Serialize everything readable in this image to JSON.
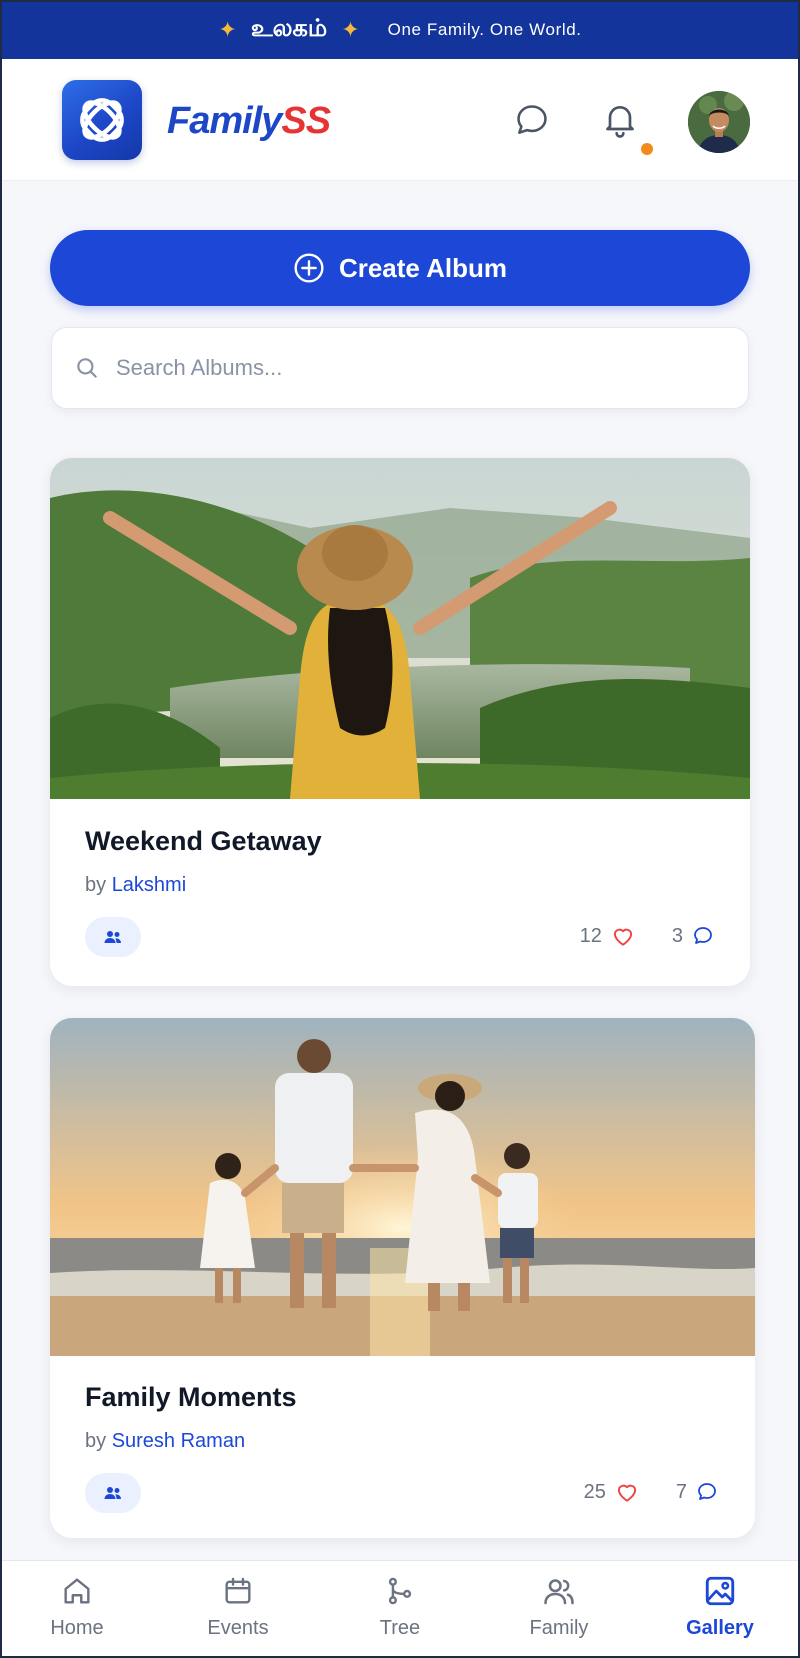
{
  "banner": {
    "title_tamil": "உலகம்",
    "tagline": "One Family. One World.",
    "star_color": "#f5b83d",
    "background_color": "#13349a"
  },
  "header": {
    "brand_part1": "Family",
    "brand_part2": "SS",
    "brand_colors": [
      "#1d47c7",
      "#e63434"
    ],
    "icons": [
      "chat-icon",
      "bell-icon"
    ],
    "notification_dot_color": "#f28a1c"
  },
  "actions": {
    "create_album_label": "Create Album",
    "accent_color": "#1d47d6"
  },
  "search": {
    "placeholder": "Search Albums...",
    "value": ""
  },
  "albums": [
    {
      "title": "Weekend Getaway",
      "by_prefix": "by",
      "author": "Lakshmi",
      "likes": "12",
      "comments": "3"
    },
    {
      "title": "Family Moments",
      "by_prefix": "by",
      "author": "Suresh Raman",
      "likes": "25",
      "comments": "7"
    }
  ],
  "nav": {
    "items": [
      {
        "label": "Home",
        "icon": "home-icon"
      },
      {
        "label": "Events",
        "icon": "calendar-icon"
      },
      {
        "label": "Tree",
        "icon": "tree-icon"
      },
      {
        "label": "Family",
        "icon": "people-icon"
      },
      {
        "label": "Gallery",
        "icon": "gallery-icon"
      }
    ],
    "active": "Gallery"
  }
}
